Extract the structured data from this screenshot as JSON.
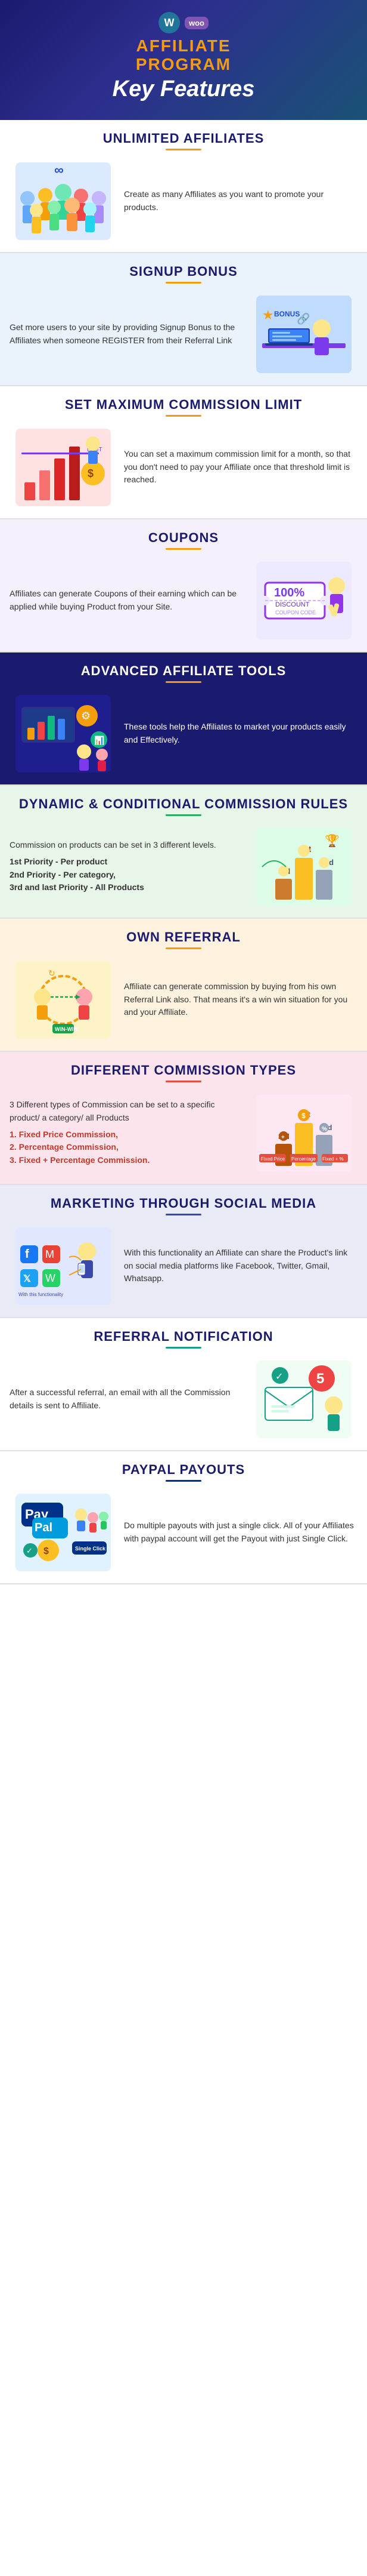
{
  "header": {
    "logos": [
      "WP",
      "Woo"
    ],
    "title_line1": "AFFILIATE",
    "title_line2": "PROGRAM",
    "subtitle": "Key Features"
  },
  "sections": [
    {
      "id": "unlimited-affiliates",
      "title": "UNLIMITED AFFILIATES",
      "text": "Create as many Affiliates as you want to promote your products.",
      "bg": "#fff",
      "textSide": "right",
      "accentColor": "#3498db"
    },
    {
      "id": "signup-bonus",
      "title": "SIGNUP BONUS",
      "text": "Get more users to your site by providing Signup Bonus to the Affiliates when someone REGISTER from their Referral Link",
      "bg": "#eaf2fb",
      "textSide": "left",
      "accentColor": "#2980b9"
    },
    {
      "id": "set-maximum",
      "title": "SET MAXIMUM COMMISSION LIMIT",
      "text": "You can set a maximum commission limit for a month, so that you don't need to pay your Affiliate once that threshold limit is reached.",
      "bg": "#fff",
      "textSide": "right",
      "accentColor": "#e74c3c"
    },
    {
      "id": "coupons",
      "title": "COUPONS",
      "text": "Affiliates can generate Coupons of their earning which can be applied while buying Product from your Site.",
      "bg": "#f5f0fb",
      "textSide": "left",
      "accentColor": "#9b59b6"
    },
    {
      "id": "advanced-tools",
      "title": "ADVANCED AFFILIATE TOOLS",
      "text": "These tools help the Affiliates to market your products easily and Effectively.",
      "bg": "#1a1a6e",
      "textSide": "right",
      "accentColor": "#f39c12",
      "dark": true
    },
    {
      "id": "dynamic-commission",
      "title": "DYNAMIC & CONDITIONAL COMMISSION RULES",
      "text": "Commission on products can be set in 3 different levels.",
      "listItems": [
        "1st Priority - Per product",
        "2nd Priority - Per category,",
        "3rd and last Priority - All Products"
      ],
      "bg": "#e8f5e9",
      "textSide": "left",
      "accentColor": "#27ae60"
    },
    {
      "id": "own-referral",
      "title": "OWN REFERRAL",
      "text": "Affiliate can generate commission by buying from his own Referral Link also. That means it's a win win situation for you and your Affiliate.",
      "bg": "#fff3e0",
      "textSide": "right",
      "accentColor": "#f39c12"
    },
    {
      "id": "different-commission",
      "title": "DIFFERENT COMMISSION TYPES",
      "text": "3 Different types of Commission can be set to a specific product/ a category/ all Products",
      "listItems": [
        "1. Fixed Price Commission,",
        "2. Percentage Commission,",
        "3. Fixed + Percentage Commission."
      ],
      "bg": "#fce4ec",
      "textSide": "left",
      "accentColor": "#e74c3c"
    },
    {
      "id": "marketing-social",
      "title": "MARKETING THROUGH SOCIAL MEDIA",
      "text": "With this functionality an Affiliate can share the Product's link on social media platforms like Facebook, Twitter, Gmail, Whatsapp.",
      "bg": "#e8eaf6",
      "textSide": "right",
      "accentColor": "#3949ab"
    },
    {
      "id": "referral-notification",
      "title": "REFERRAL NOTIFICATION",
      "text": "After a successful referral, an email with all the Commission details is sent to Affiliate.",
      "bg": "#fff",
      "textSide": "left",
      "accentColor": "#16a085"
    },
    {
      "id": "paypal-payouts",
      "title": "PAYPAL PAYOUTS",
      "text": "Do multiple payouts with just a single click. All of your Affiliates with paypal account will get the Payout with just Single Click.",
      "bg": "#fff",
      "textSide": "right",
      "accentColor": "#003087"
    }
  ]
}
